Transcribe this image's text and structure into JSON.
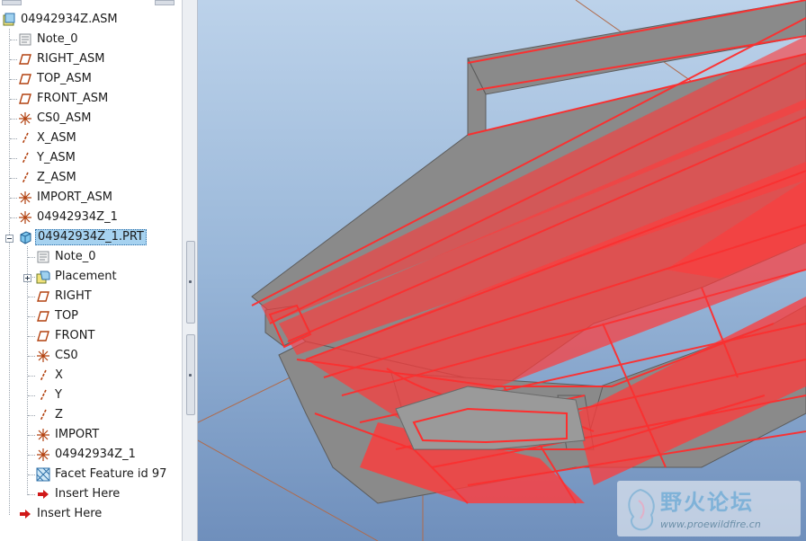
{
  "tree": {
    "root": {
      "label": "04942934Z.ASM",
      "icon": "assembly-icon"
    },
    "items": [
      {
        "label": "Note_0",
        "icon": "note-icon"
      },
      {
        "label": "RIGHT_ASM",
        "icon": "datum-plane-icon"
      },
      {
        "label": "TOP_ASM",
        "icon": "datum-plane-icon"
      },
      {
        "label": "FRONT_ASM",
        "icon": "datum-plane-icon"
      },
      {
        "label": "CS0_ASM",
        "icon": "coordinate-system-icon"
      },
      {
        "label": "X_ASM",
        "icon": "datum-axis-icon"
      },
      {
        "label": "Y_ASM",
        "icon": "datum-axis-icon"
      },
      {
        "label": "Z_ASM",
        "icon": "datum-axis-icon"
      },
      {
        "label": "IMPORT_ASM",
        "icon": "coordinate-system-icon"
      },
      {
        "label": "04942934Z_1",
        "icon": "coordinate-system-icon"
      }
    ],
    "part": {
      "label": "04942934Z_1.PRT",
      "icon": "part-icon",
      "selected": true,
      "children": [
        {
          "label": "Note_0",
          "icon": "note-icon"
        },
        {
          "label": "Placement",
          "icon": "placement-icon"
        },
        {
          "label": "RIGHT",
          "icon": "datum-plane-icon"
        },
        {
          "label": "TOP",
          "icon": "datum-plane-icon"
        },
        {
          "label": "FRONT",
          "icon": "datum-plane-icon"
        },
        {
          "label": "CS0",
          "icon": "coordinate-system-icon"
        },
        {
          "label": "X",
          "icon": "datum-axis-icon"
        },
        {
          "label": "Y",
          "icon": "datum-axis-icon"
        },
        {
          "label": "Z",
          "icon": "datum-axis-icon"
        },
        {
          "label": "IMPORT",
          "icon": "coordinate-system-icon"
        },
        {
          "label": "04942934Z_1",
          "icon": "coordinate-system-icon"
        },
        {
          "label": "Facet Feature id 97",
          "icon": "facet-feature-icon"
        },
        {
          "label": "Insert Here",
          "icon": "insert-arrow-icon"
        }
      ]
    },
    "asm_insert": {
      "label": "Insert Here",
      "icon": "insert-arrow-icon"
    }
  },
  "colors": {
    "background_top": "#bcd2ea",
    "background_bottom": "#6f8fbc",
    "model_gray": "#8a8a8a",
    "facet_red": "#ff3333",
    "selection": "#a6d2f0"
  },
  "watermark": {
    "title": "野火论坛",
    "url": "www.proewildfire.cn"
  }
}
